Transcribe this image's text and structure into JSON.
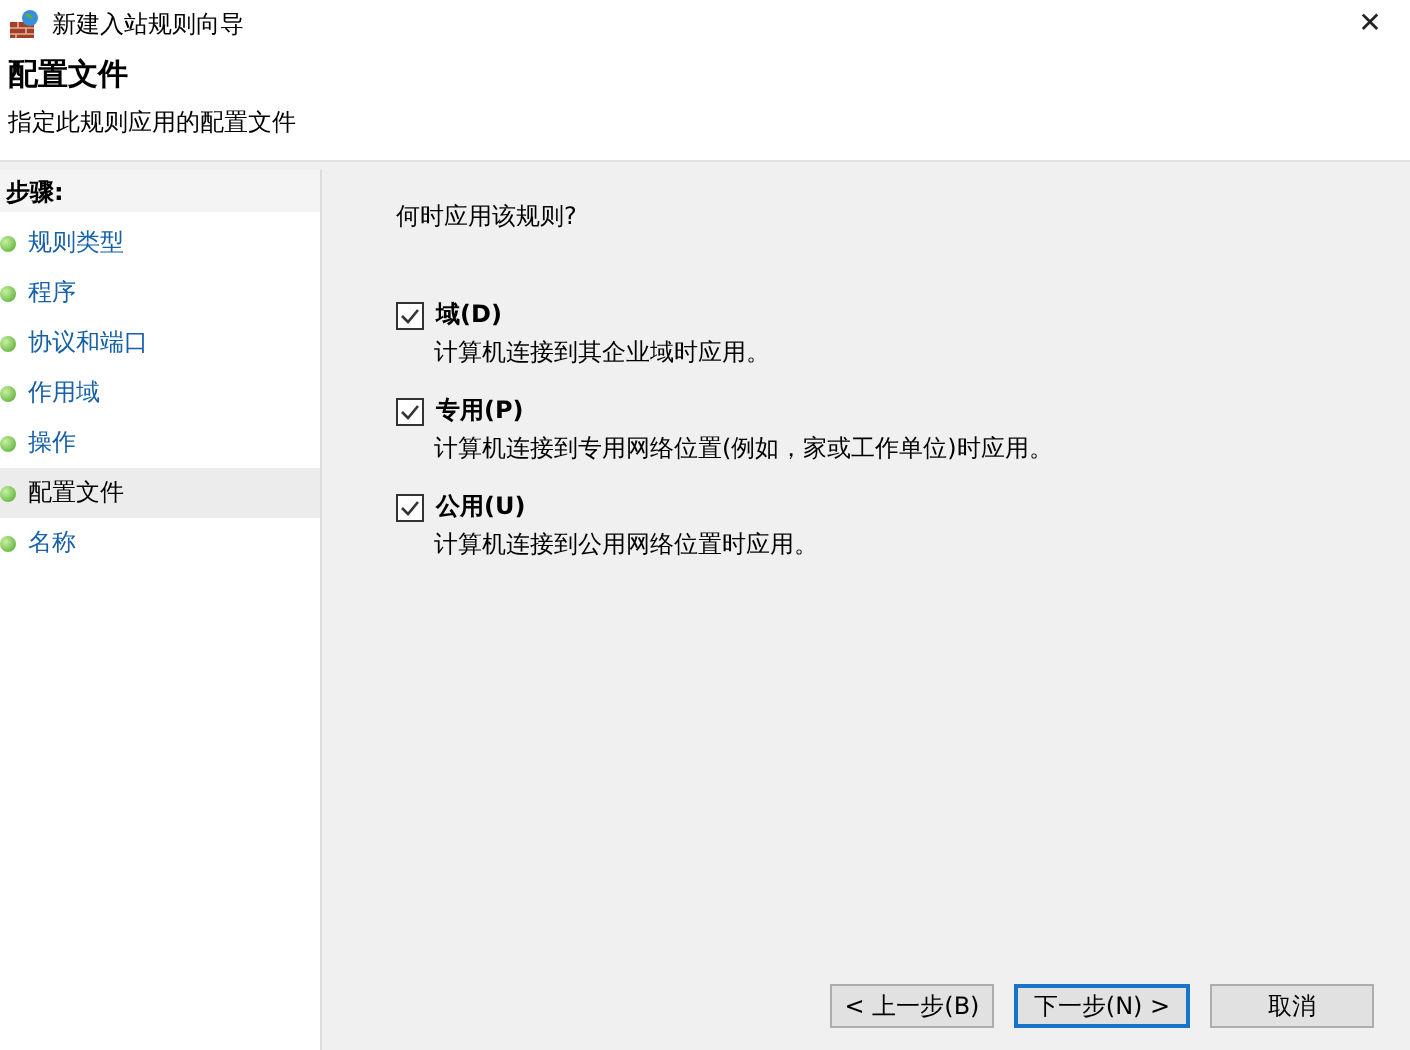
{
  "window": {
    "title": "新建入站规则向导",
    "close": "✕"
  },
  "header": {
    "title": "配置文件",
    "subtitle": "指定此规则应用的配置文件"
  },
  "sidebar": {
    "title": "步骤:",
    "items": [
      {
        "label": "规则类型",
        "selected": false
      },
      {
        "label": "程序",
        "selected": false
      },
      {
        "label": "协议和端口",
        "selected": false
      },
      {
        "label": "作用域",
        "selected": false
      },
      {
        "label": "操作",
        "selected": false
      },
      {
        "label": "配置文件",
        "selected": true
      },
      {
        "label": "名称",
        "selected": false
      }
    ]
  },
  "content": {
    "question": "何时应用该规则?",
    "options": [
      {
        "label": "域(D)",
        "description": "计算机连接到其企业域时应用。",
        "checked": true
      },
      {
        "label": "专用(P)",
        "description": "计算机连接到专用网络位置(例如，家或工作单位)时应用。",
        "checked": true
      },
      {
        "label": "公用(U)",
        "description": "计算机连接到公用网络位置时应用。",
        "checked": true
      }
    ]
  },
  "buttons": [
    {
      "label": "< 上一步(B)",
      "kind": "normal"
    },
    {
      "label": "下一步(N) >",
      "kind": "default"
    },
    {
      "label": "取消",
      "kind": "normal"
    }
  ]
}
